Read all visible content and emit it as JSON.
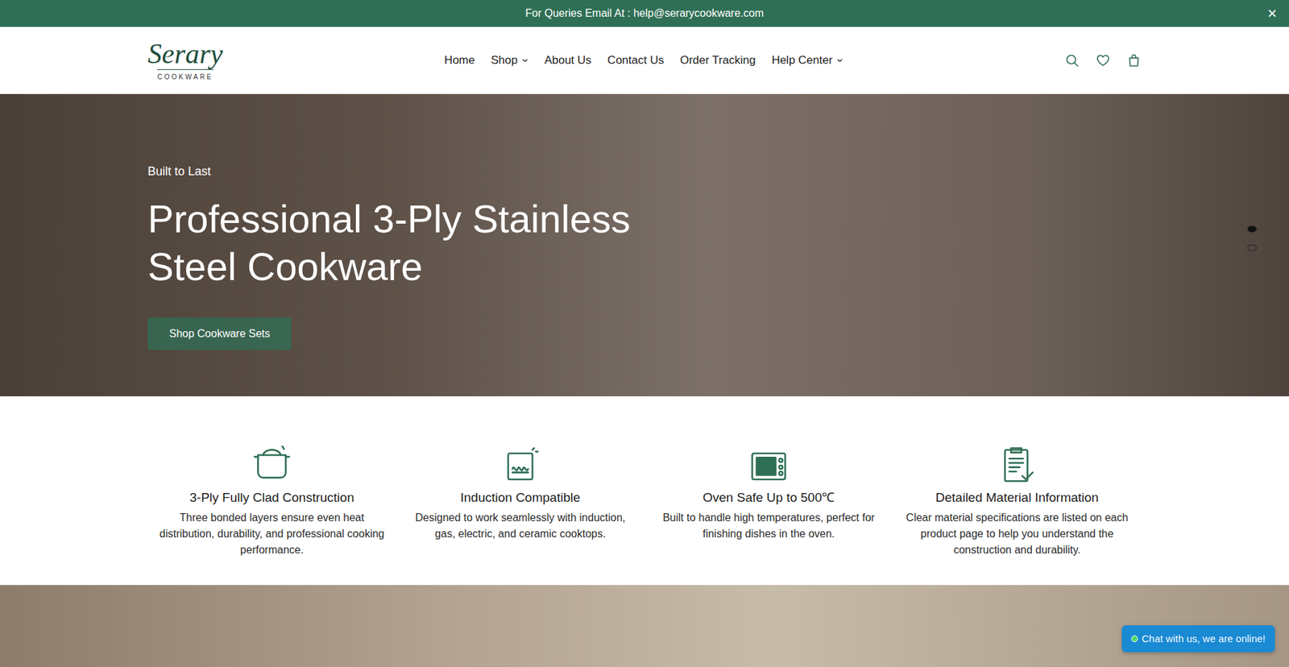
{
  "announcement": {
    "text": "For Queries Email At : help@serarycookware.com",
    "close": "×"
  },
  "header": {
    "logo": {
      "name": "Serary",
      "tagline": "COOKWARE"
    },
    "nav": [
      {
        "label": "Home",
        "dropdown": false
      },
      {
        "label": "Shop",
        "dropdown": true
      },
      {
        "label": "About Us",
        "dropdown": false
      },
      {
        "label": "Contact Us",
        "dropdown": false
      },
      {
        "label": "Order Tracking",
        "dropdown": false
      },
      {
        "label": "Help Center",
        "dropdown": true
      }
    ]
  },
  "hero": {
    "eyebrow": "Built to Last",
    "title": "Professional 3-Ply Stainless Steel Cookware",
    "button": "Shop Cookware Sets",
    "slides": [
      {
        "selected": true
      },
      {
        "selected": false
      }
    ]
  },
  "features": [
    {
      "kind": "pot",
      "title": "3-Ply Fully Clad Construction",
      "text": "Three bonded layers ensure even heat distribution, durability, and professional cooking performance."
    },
    {
      "kind": "induction",
      "title": "Induction Compatible",
      "text": "Designed to work seamlessly with induction, gas, electric, and ceramic cooktops."
    },
    {
      "kind": "oven",
      "title": "Oven Safe Up to 500℃",
      "text": "Built to handle high temperatures, perfect for finishing dishes in the oven."
    },
    {
      "kind": "clipboard",
      "title": "Detailed Material Information",
      "text": "Clear material specifications are listed on each product page to help you understand the construction and durability."
    }
  ],
  "chat": {
    "label": "Chat with us, we are online!"
  }
}
